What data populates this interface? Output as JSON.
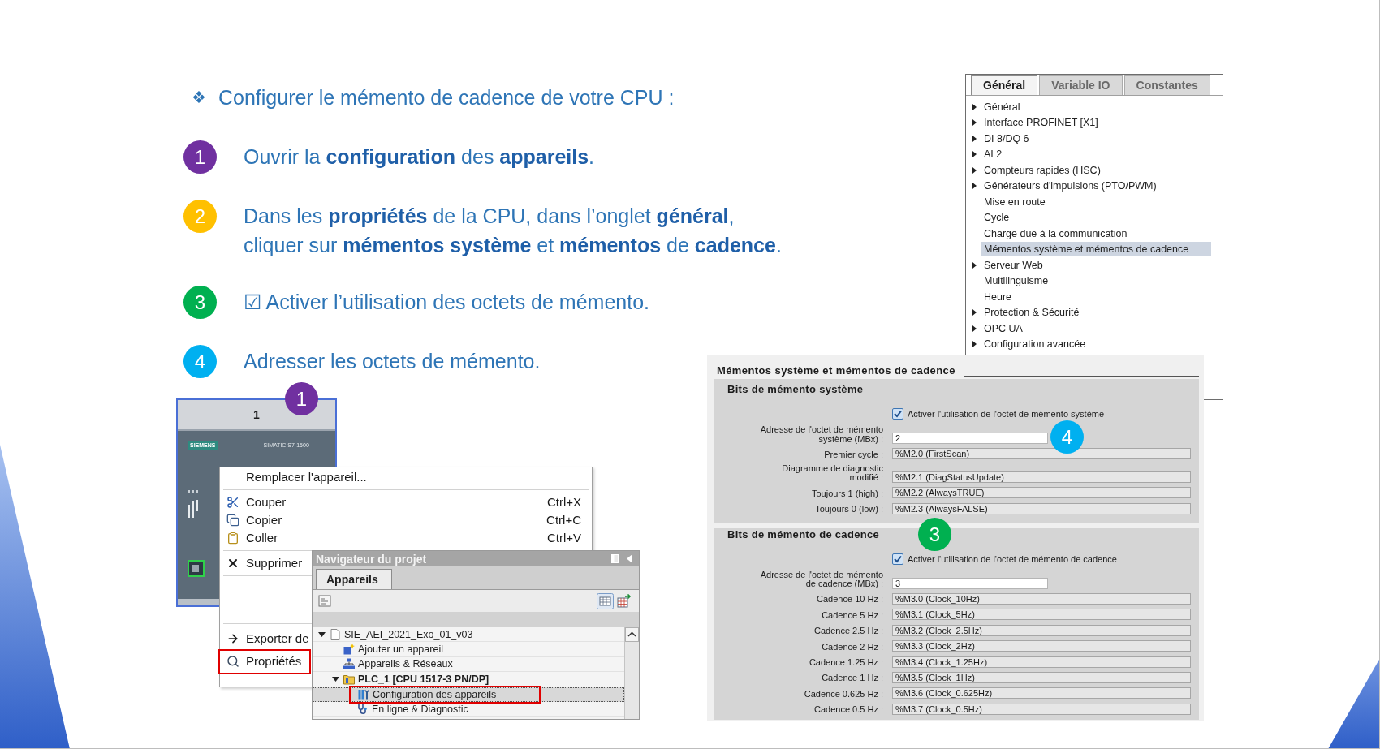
{
  "heading": {
    "bullet": "❖",
    "text": "Configurer le mémento de cadence de votre CPU :"
  },
  "steps": [
    {
      "number": "1",
      "color": "#7030a0",
      "lines": [
        "Ouvrir la **configuration** des **appareils**."
      ]
    },
    {
      "number": "2",
      "color": "#ffc000",
      "lines": [
        "Dans les **propriétés** de la CPU, dans l’onglet **général**,",
        "cliquer sur **mémentos système** et **mémentos** de **cadence**."
      ]
    },
    {
      "number": "3",
      "color": "#00b050",
      "lines": [
        "☑ Activer l’utilisation des octets de mémento."
      ]
    },
    {
      "number": "4",
      "color": "#00b0f0",
      "lines": [
        "Adresser les octets de mémento."
      ]
    }
  ],
  "device_view": {
    "slot": "1",
    "brand": "SIEMENS",
    "model": "SIMATIC S7-1500"
  },
  "context_menu": {
    "groups": [
      [
        {
          "kind": "replace",
          "label": "Remplacer l'appareil...",
          "marked": false
        }
      ],
      [
        {
          "kind": "cut",
          "label": "Couper",
          "shortcut": "Ctrl+X",
          "marked": false
        },
        {
          "kind": "copy",
          "label": "Copier",
          "shortcut": "Ctrl+C",
          "marked": false
        },
        {
          "kind": "paste",
          "label": "Coller",
          "shortcut": "Ctrl+V",
          "marked": false
        }
      ],
      [
        {
          "kind": "delete",
          "label": "Supprimer",
          "marked": false
        }
      ],
      [
        {
          "kind": "export",
          "label": "Exporter de",
          "marked": false
        },
        {
          "kind": "properties",
          "label": "Propriétés",
          "marked": true
        }
      ]
    ]
  },
  "project_navigator": {
    "title": "Navigateur du projet",
    "tabs": [
      {
        "label": "Appareils",
        "selected": true
      }
    ],
    "tree": [
      {
        "kind": "project",
        "label": "SIE_AEI_2021_Exo_01_v03",
        "expanded": true,
        "selected": false,
        "marked": false,
        "children": [
          {
            "kind": "add",
            "label": "Ajouter un appareil",
            "selected": false,
            "marked": false
          },
          {
            "kind": "network",
            "label": "Appareils & Réseaux",
            "selected": false,
            "marked": false
          },
          {
            "kind": "device",
            "label": "PLC_1 [CPU 1517-3 PN/DP]",
            "expanded": true,
            "selected": false,
            "marked": false,
            "children": [
              {
                "kind": "config",
                "label": "Configuration des appareils",
                "selected": true,
                "marked": true
              },
              {
                "kind": "diagnostic",
                "label": "En ligne & Diagnostic",
                "selected": false,
                "marked": false
              }
            ]
          }
        ]
      }
    ]
  },
  "properties_panel": {
    "tabs": [
      {
        "label": "Général",
        "selected": true
      },
      {
        "label": "Variable IO",
        "selected": false
      },
      {
        "label": "Constantes",
        "selected": false
      }
    ],
    "items": [
      {
        "label": "Général",
        "expandable": true,
        "selected": false
      },
      {
        "label": "Interface PROFINET [X1]",
        "expandable": true,
        "selected": false
      },
      {
        "label": "DI 8/DQ 6",
        "expandable": true,
        "selected": false
      },
      {
        "label": "AI 2",
        "expandable": true,
        "selected": false
      },
      {
        "label": "Compteurs rapides (HSC)",
        "expandable": true,
        "selected": false
      },
      {
        "label": "Générateurs d'impulsions (PTO/PWM)",
        "expandable": true,
        "selected": false
      },
      {
        "label": "Mise en route",
        "expandable": false,
        "selected": false
      },
      {
        "label": "Cycle",
        "expandable": false,
        "selected": false
      },
      {
        "label": "Charge due à la communication",
        "expandable": false,
        "selected": false
      },
      {
        "label": "Mémentos système et mémentos de cadence",
        "expandable": false,
        "selected": true
      },
      {
        "label": "Serveur Web",
        "expandable": true,
        "selected": false
      },
      {
        "label": "Multilinguisme",
        "expandable": false,
        "selected": false
      },
      {
        "label": "Heure",
        "expandable": false,
        "selected": false
      },
      {
        "label": "Protection & Sécurité",
        "expandable": true,
        "selected": false
      },
      {
        "label": "OPC UA",
        "expandable": true,
        "selected": false
      },
      {
        "label": "Configuration avancée",
        "expandable": true,
        "selected": false
      }
    ]
  },
  "memento_panel": {
    "title": "Mémentos système et mémentos de cadence",
    "sections": [
      {
        "title": "Bits de mémento système",
        "checkbox": {
          "label": "Activer l'utilisation de l'octet de mémento système",
          "checked": true
        },
        "fields": [
          {
            "label": [
              "Adresse de l'octet de mémento",
              "système (MBx) :"
            ],
            "value": "2",
            "editable": true
          },
          {
            "label": [
              "Premier cycle :"
            ],
            "value": "%M2.0 (FirstScan)",
            "editable": false
          },
          {
            "label": [
              "Diagramme de diagnostic",
              "modifié :"
            ],
            "value": "%M2.1 (DiagStatusUpdate)",
            "editable": false
          },
          {
            "label": [
              "Toujours 1 (high) :"
            ],
            "value": "%M2.2 (AlwaysTRUE)",
            "editable": false
          },
          {
            "label": [
              "Toujours 0 (low) :"
            ],
            "value": "%M2.3 (AlwaysFALSE)",
            "editable": false
          }
        ]
      },
      {
        "title": "Bits de mémento de cadence",
        "checkbox": {
          "label": "Activer l'utilisation de l'octet de mémento de cadence",
          "checked": true
        },
        "fields": [
          {
            "label": [
              "Adresse de l'octet de mémento",
              "de cadence (MBx) :"
            ],
            "value": "3",
            "editable": true
          },
          {
            "label": [
              "Cadence 10 Hz :"
            ],
            "value": "%M3.0 (Clock_10Hz)",
            "editable": false
          },
          {
            "label": [
              "Cadence 5 Hz :"
            ],
            "value": "%M3.1 (Clock_5Hz)",
            "editable": false
          },
          {
            "label": [
              "Cadence 2.5 Hz :"
            ],
            "value": "%M3.2 (Clock_2.5Hz)",
            "editable": false
          },
          {
            "label": [
              "Cadence 2 Hz :"
            ],
            "value": "%M3.3 (Clock_2Hz)",
            "editable": false
          },
          {
            "label": [
              "Cadence 1.25 Hz :"
            ],
            "value": "%M3.4 (Clock_1.25Hz)",
            "editable": false
          },
          {
            "label": [
              "Cadence 1 Hz :"
            ],
            "value": "%M3.5 (Clock_1Hz)",
            "editable": false
          },
          {
            "label": [
              "Cadence 0.625 Hz :"
            ],
            "value": "%M3.6 (Clock_0.625Hz)",
            "editable": false
          },
          {
            "label": [
              "Cadence 0.5 Hz :"
            ],
            "value": "%M3.7 (Clock_0.5Hz)",
            "editable": false
          }
        ]
      }
    ]
  },
  "callouts": [
    {
      "number": "1",
      "color": "#7030a0"
    },
    {
      "number": "4",
      "color": "#00b0f0"
    },
    {
      "number": "3",
      "color": "#00b050"
    }
  ]
}
